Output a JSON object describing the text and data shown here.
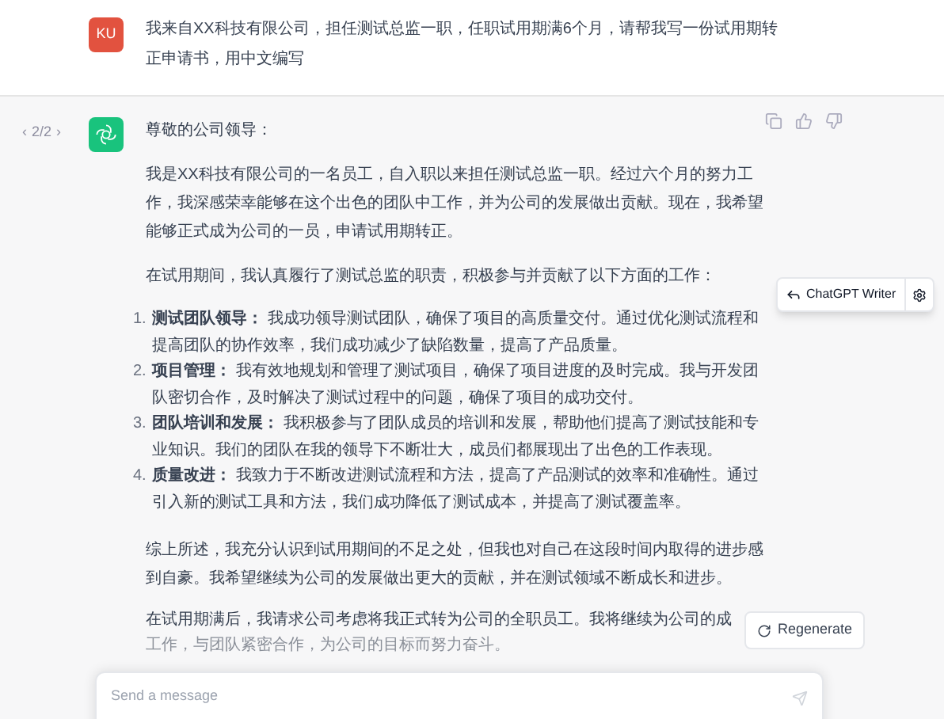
{
  "user_message": {
    "avatar": "KU",
    "text": "我来自XX科技有限公司，担任测试总监一职，任职试用期满6个月，请帮我写一份试用期转正申请书，用中文编写"
  },
  "assistant_message": {
    "pager": {
      "prev": "‹",
      "label": "2/2",
      "next": "›"
    },
    "greeting": "尊敬的公司领导：",
    "paragraphs": [
      "我是XX科技有限公司的一名员工，自入职以来担任测试总监一职。经过六个月的努力工作，我深感荣幸能够在这个出色的团队中工作，并为公司的发展做出贡献。现在，我希望能够正式成为公司的一员，申请试用期转正。",
      "在试用期间，我认真履行了测试总监的职责，积极参与并贡献了以下方面的工作："
    ],
    "list": [
      {
        "number": "1.",
        "text": "**测试团队领导：** 我成功领导测试团队，确保了项目的高质量交付。通过优化测试流程和提高团队的协作效率，我们成功减少了缺陷数量，提高了产品质量。"
      },
      {
        "number": "2.",
        "text": "**项目管理：** 我有效地规划和管理了测试项目，确保了项目进度的及时完成。我与开发团队密切合作，及时解决了测试过程中的问题，确保了项目的成功交付。"
      },
      {
        "number": "3.",
        "text": "**团队培训和发展：** 我积极参与了团队成员的培训和发展，帮助他们提高了测试技能和专业知识。我们的团队在我的领导下不断壮大，成员们都展现出了出色的工作表现。"
      },
      {
        "number": "4.",
        "text": "**质量改进：** 我致力于不断改进测试流程和方法，提高了产品测试的效率和准确性。通过引入新的测试工具和方法，我们成功降低了测试成本，并提高了测试覆盖率。"
      }
    ],
    "summary": "综上所述，我充分认识到试用期间的不足之处，但我也对自己在这段时间内取得的进步感到自豪。我希望继续为公司的发展做出更大的贡献，并在测试领域不断成长和进步。",
    "closing_lines": [
      "在试用期满后，我请求公司考虑将我正式转为公司的全职员工。我将继续为公司的成",
      "工作，与团队紧密合作，为公司的目标而努力奋斗。"
    ]
  },
  "writer_button": {
    "label": "ChatGPT Writer"
  },
  "regenerate_button": {
    "label": "Regenerate"
  },
  "composer": {
    "placeholder": "Send a message"
  }
}
